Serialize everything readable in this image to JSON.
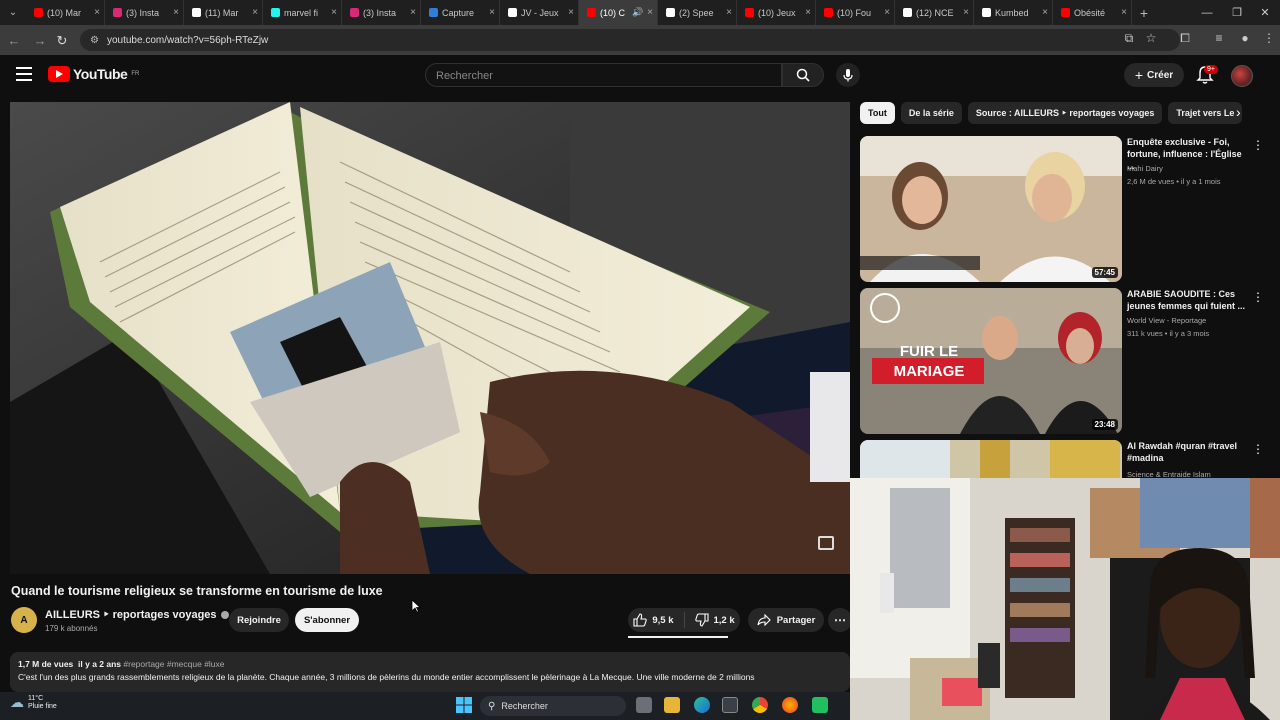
{
  "browser": {
    "tabs": [
      {
        "label": "(10) Mar",
        "color": "#ff0000"
      },
      {
        "label": "(3) Insta",
        "color": "#d62976"
      },
      {
        "label": "(11) Mar",
        "color": "#ffffff"
      },
      {
        "label": "marvel fi",
        "color": "#25f4ee"
      },
      {
        "label": "(3) Insta",
        "color": "#d62976"
      },
      {
        "label": "Capture",
        "color": "#2f7fd8"
      },
      {
        "label": "JV - Jeux",
        "color": "#ffffff"
      },
      {
        "label": "(10) C",
        "color": "#ff0000",
        "active": true
      },
      {
        "label": "(2) Spee",
        "color": "#ffffff"
      },
      {
        "label": "(10) Jeux",
        "color": "#ff0000"
      },
      {
        "label": "(10) Fou",
        "color": "#ff0000"
      },
      {
        "label": "(12) NCE",
        "color": "#ffffff"
      },
      {
        "label": "Kumbed",
        "color": "#ffffff"
      },
      {
        "label": "Obésité",
        "color": "#ff0000"
      }
    ],
    "url": "youtube.com/watch?v=56ph-RTeZjw"
  },
  "header": {
    "logo_text": "YouTube",
    "logo_region": "FR",
    "search_placeholder": "Rechercher",
    "create_label": "Créer",
    "notif_badge": "9+"
  },
  "video": {
    "title": "Quand le tourisme religieux se transforme en tourisme de luxe",
    "channel": "AILLEURS ‣ reportages voyages",
    "subscribers": "179 k abonnés",
    "join_label": "Rejoindre",
    "subscribe_label": "S'abonner",
    "likes": "9,5 k",
    "dislikes": "1,2 k",
    "share_label": "Partager",
    "views": "1,7 M de vues",
    "age": "il y a 2 ans",
    "tags": "#reportage #mecque #luxe",
    "description": "C'est l'un des plus grands rassemblements religieux de la planète. Chaque année, 3 millions de pèlerins du monde entier accomplissent le pèlerinage à La Mecque. Une ville moderne de 2 millions"
  },
  "chips": [
    "Tout",
    "De la série",
    "Source : AILLEURS ‣ reportages voyages",
    "Trajet vers Le"
  ],
  "recommendations": [
    {
      "title": "Enquête exclusive - Foi, fortune, influence : l'Église ...",
      "channel": "Mahi Dairy",
      "meta": "2,6 M de vues • il y a 1 mois",
      "duration": "57:45"
    },
    {
      "title": "ARABIE SAOUDITE : Ces jeunes femmes qui fuient ...",
      "channel": "World View - Reportage",
      "meta": "311 k vues • il y a 3 mois",
      "duration": "23:48",
      "overlay": "FUIR LE MARIAGE"
    },
    {
      "title": "Al Rawdah #quran #travel #madina",
      "channel": "Science & Entraide Islam",
      "meta": "",
      "duration": ""
    }
  ],
  "taskbar": {
    "temperature": "11°C",
    "weather": "Pluie fine",
    "search_label": "Rechercher"
  }
}
